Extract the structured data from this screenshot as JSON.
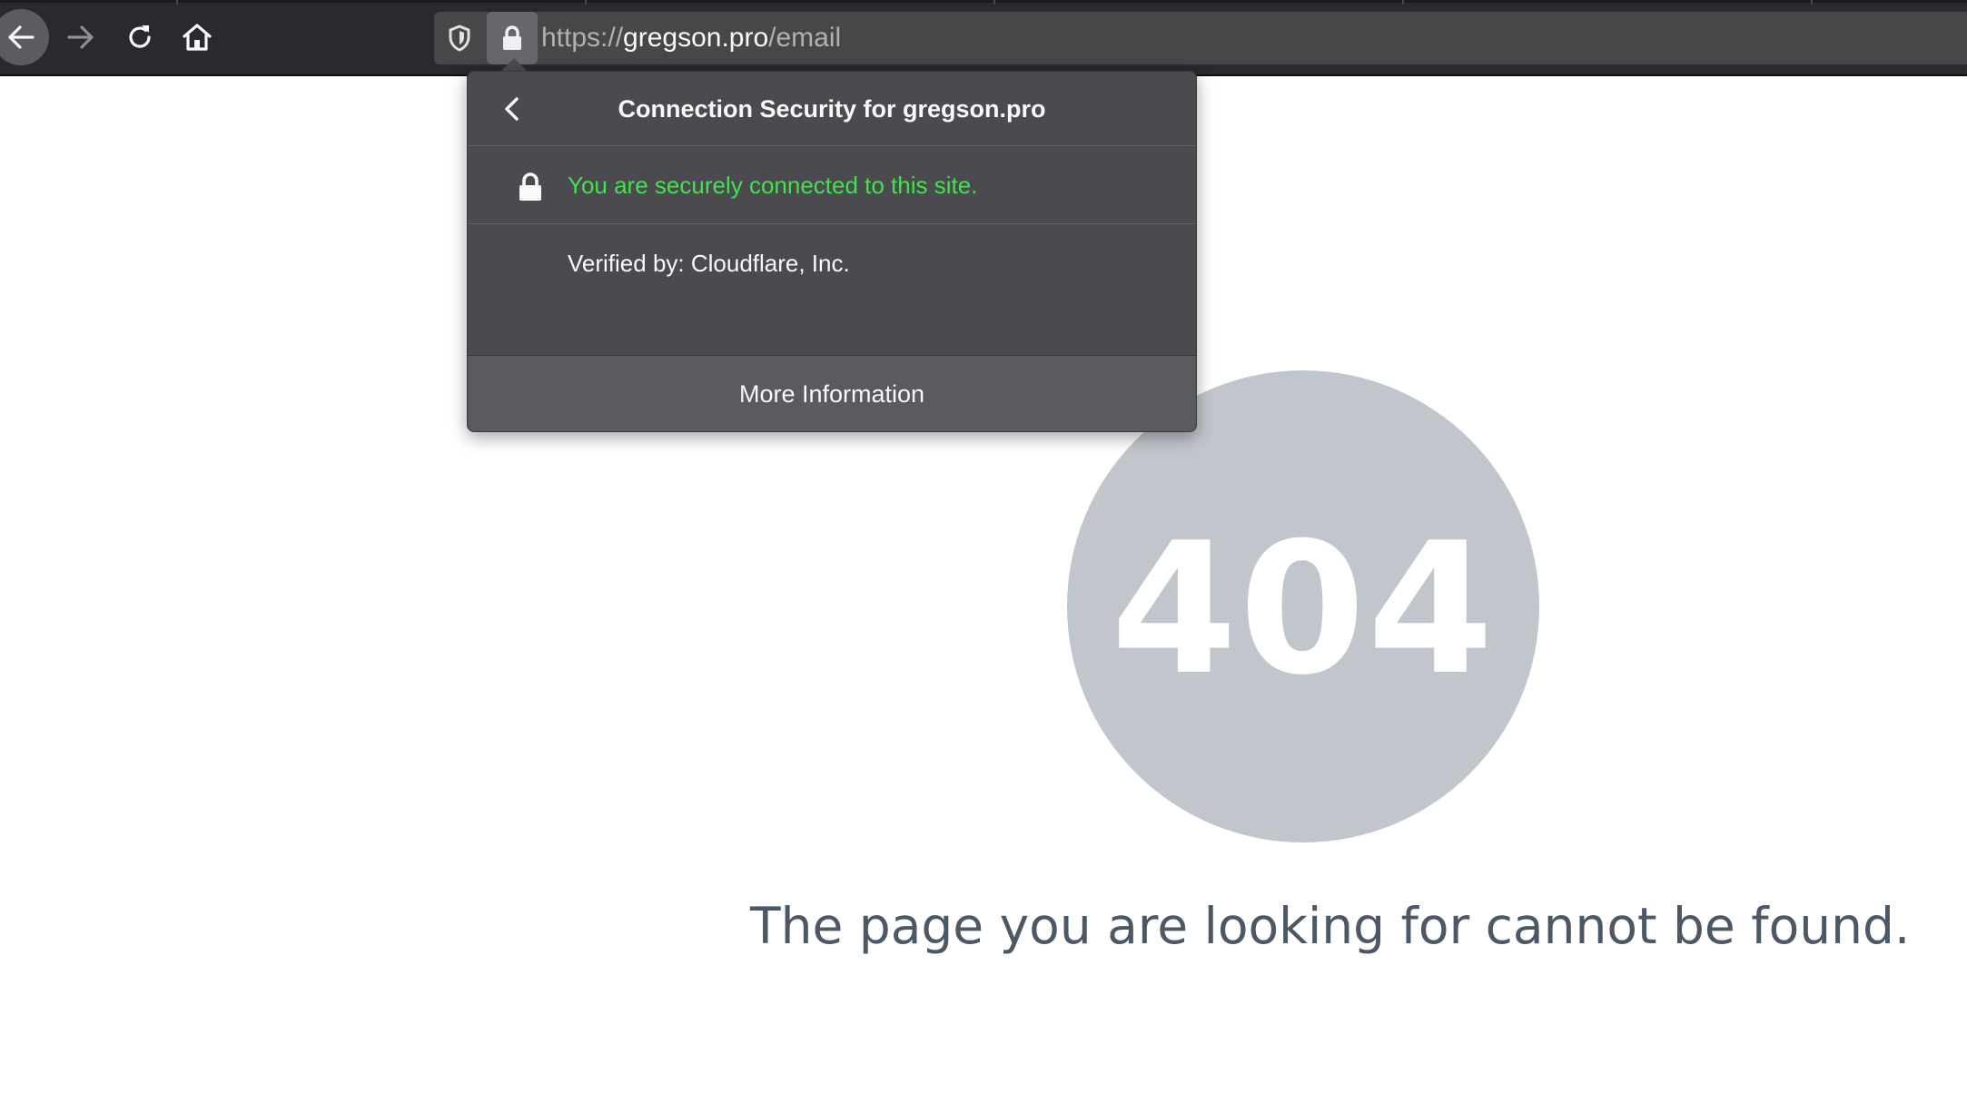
{
  "browser": {
    "url": {
      "scheme": "https://",
      "host": "gregson.pro",
      "path": "/email"
    }
  },
  "popup": {
    "title": "Connection Security for gregson.pro",
    "secure_message": "You are securely connected to this site.",
    "verified_by": "Verified by: Cloudflare, Inc.",
    "more_info_label": "More Information",
    "secure_color": "#45e04f"
  },
  "page": {
    "error_code": "404",
    "error_message": "The page you are looking for cannot be found.",
    "circle_color": "#c1c6cd"
  },
  "icons": {
    "back": "arrow-left-icon",
    "forward": "arrow-right-icon",
    "reload": "reload-icon",
    "home": "home-icon",
    "tracking": "shield-icon",
    "site_security": "lock-icon",
    "popup_back": "chevron-left-icon"
  }
}
